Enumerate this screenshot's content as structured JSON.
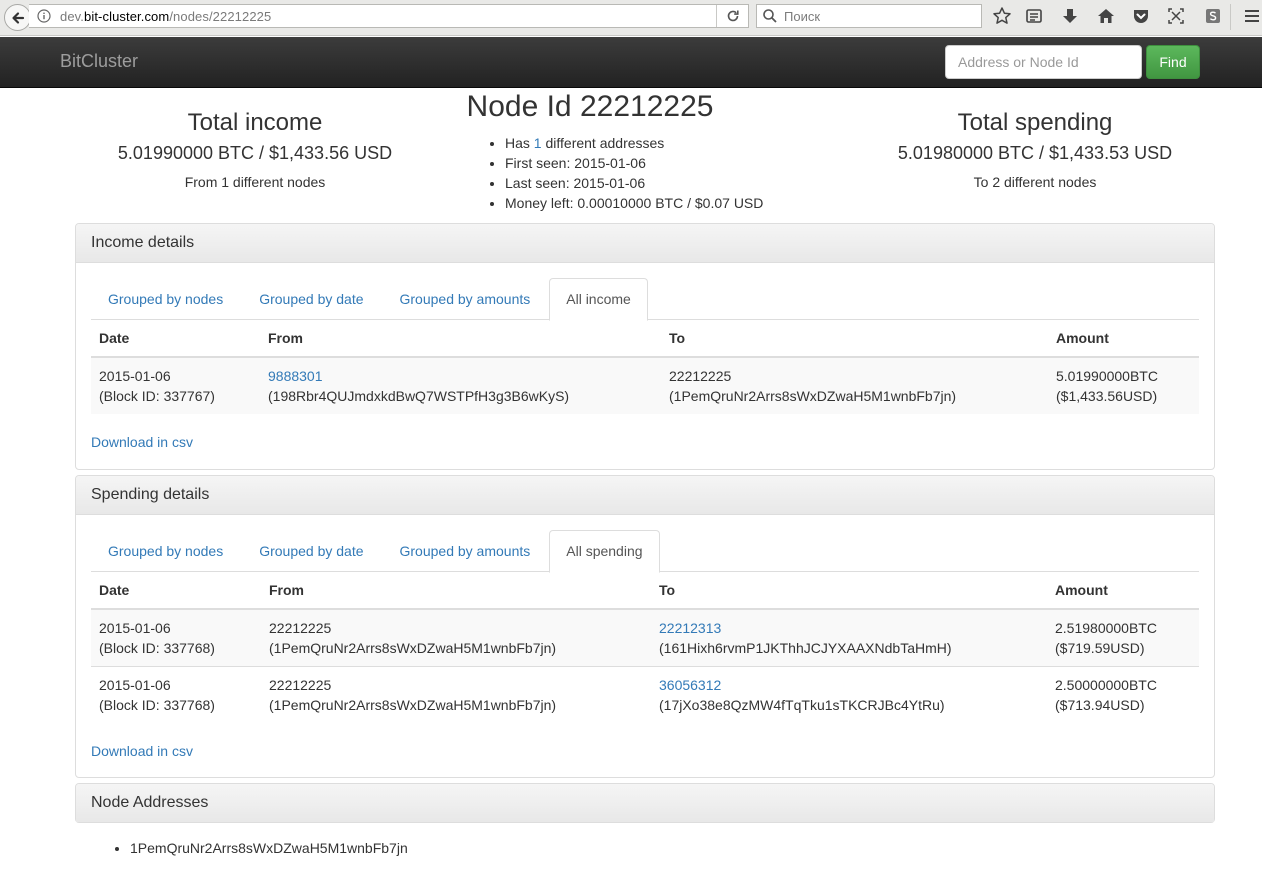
{
  "browser": {
    "url_host_prefix": "dev.",
    "url_host": "bit-cluster.com",
    "url_path": "/nodes/22212225",
    "search_placeholder": "Поиск"
  },
  "navbar": {
    "brand": "BitCluster",
    "search_placeholder": "Address or Node Id",
    "find_label": "Find"
  },
  "summary": {
    "income": {
      "title": "Total income",
      "amount": "5.01990000 BTC / $1,433.56 USD",
      "nodes": "From 1 different nodes"
    },
    "node": {
      "title": "Node Id 22212225",
      "has_prefix": "Has ",
      "has_count": "1",
      "has_suffix": " different addresses",
      "first_seen": "First seen: 2015-01-06",
      "last_seen": "Last seen: 2015-01-06",
      "money_left": "Money left: 0.00010000 BTC / $0.07 USD"
    },
    "spending": {
      "title": "Total spending",
      "amount": "5.01980000 BTC / $1,433.53 USD",
      "nodes": "To 2 different nodes"
    }
  },
  "income": {
    "heading": "Income details",
    "tabs": [
      "Grouped by nodes",
      "Grouped by date",
      "Grouped by amounts",
      "All income"
    ],
    "columns": [
      "Date",
      "From",
      "To",
      "Amount"
    ],
    "rows": [
      {
        "date": "2015-01-06",
        "block": "(Block ID: 337767)",
        "from_id": "9888301",
        "from_addr": "(198Rbr4QUJmdxkdBwQ7WSTPfH3g3B6wKyS)",
        "to_id": "22212225",
        "to_addr": "(1PemQruNr2Arrs8sWxDZwaH5M1wnbFb7jn)",
        "btc": "5.01990000BTC",
        "usd": "($1,433.56USD)"
      }
    ],
    "csv": "Download in csv"
  },
  "spending": {
    "heading": "Spending details",
    "tabs": [
      "Grouped by nodes",
      "Grouped by date",
      "Grouped by amounts",
      "All spending"
    ],
    "columns": [
      "Date",
      "From",
      "To",
      "Amount"
    ],
    "rows": [
      {
        "date": "2015-01-06",
        "block": "(Block ID: 337768)",
        "from_id": "22212225",
        "from_addr": "(1PemQruNr2Arrs8sWxDZwaH5M1wnbFb7jn)",
        "to_id": "22212313",
        "to_addr": "(161Hixh6rvmP1JKThhJCJYXAAXNdbTaHmH)",
        "btc": "2.51980000BTC",
        "usd": "($719.59USD)"
      },
      {
        "date": "2015-01-06",
        "block": "(Block ID: 337768)",
        "from_id": "22212225",
        "from_addr": "(1PemQruNr2Arrs8sWxDZwaH5M1wnbFb7jn)",
        "to_id": "36056312",
        "to_addr": "(17jXo38e8QzMW4fTqTku1sTKCRJBc4YtRu)",
        "btc": "2.50000000BTC",
        "usd": "($713.94USD)"
      }
    ],
    "csv": "Download in csv"
  },
  "addresses": {
    "heading": "Node Addresses",
    "items": [
      "1PemQruNr2Arrs8sWxDZwaH5M1wnbFb7jn"
    ]
  }
}
